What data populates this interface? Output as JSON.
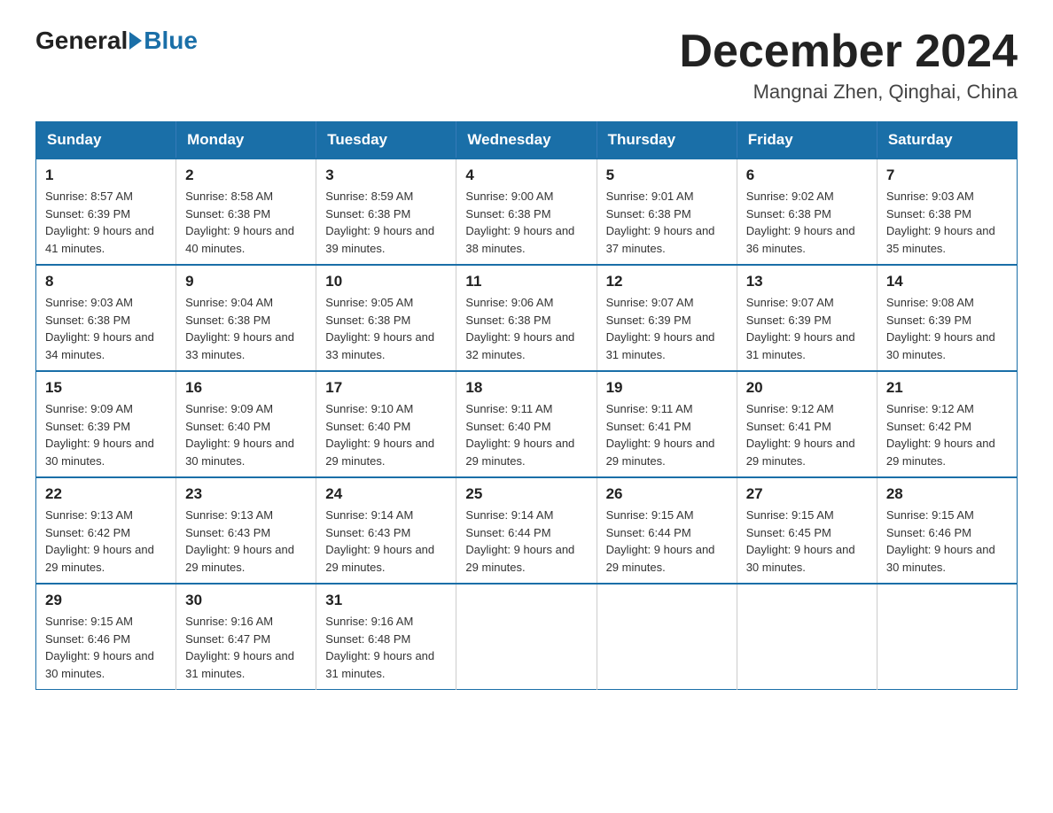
{
  "header": {
    "logo_general": "General",
    "logo_blue": "Blue",
    "month_title": "December 2024",
    "location": "Mangnai Zhen, Qinghai, China"
  },
  "days_of_week": [
    "Sunday",
    "Monday",
    "Tuesday",
    "Wednesday",
    "Thursday",
    "Friday",
    "Saturday"
  ],
  "weeks": [
    [
      {
        "day": "1",
        "sunrise": "8:57 AM",
        "sunset": "6:39 PM",
        "daylight": "9 hours and 41 minutes."
      },
      {
        "day": "2",
        "sunrise": "8:58 AM",
        "sunset": "6:38 PM",
        "daylight": "9 hours and 40 minutes."
      },
      {
        "day": "3",
        "sunrise": "8:59 AM",
        "sunset": "6:38 PM",
        "daylight": "9 hours and 39 minutes."
      },
      {
        "day": "4",
        "sunrise": "9:00 AM",
        "sunset": "6:38 PM",
        "daylight": "9 hours and 38 minutes."
      },
      {
        "day": "5",
        "sunrise": "9:01 AM",
        "sunset": "6:38 PM",
        "daylight": "9 hours and 37 minutes."
      },
      {
        "day": "6",
        "sunrise": "9:02 AM",
        "sunset": "6:38 PM",
        "daylight": "9 hours and 36 minutes."
      },
      {
        "day": "7",
        "sunrise": "9:03 AM",
        "sunset": "6:38 PM",
        "daylight": "9 hours and 35 minutes."
      }
    ],
    [
      {
        "day": "8",
        "sunrise": "9:03 AM",
        "sunset": "6:38 PM",
        "daylight": "9 hours and 34 minutes."
      },
      {
        "day": "9",
        "sunrise": "9:04 AM",
        "sunset": "6:38 PM",
        "daylight": "9 hours and 33 minutes."
      },
      {
        "day": "10",
        "sunrise": "9:05 AM",
        "sunset": "6:38 PM",
        "daylight": "9 hours and 33 minutes."
      },
      {
        "day": "11",
        "sunrise": "9:06 AM",
        "sunset": "6:38 PM",
        "daylight": "9 hours and 32 minutes."
      },
      {
        "day": "12",
        "sunrise": "9:07 AM",
        "sunset": "6:39 PM",
        "daylight": "9 hours and 31 minutes."
      },
      {
        "day": "13",
        "sunrise": "9:07 AM",
        "sunset": "6:39 PM",
        "daylight": "9 hours and 31 minutes."
      },
      {
        "day": "14",
        "sunrise": "9:08 AM",
        "sunset": "6:39 PM",
        "daylight": "9 hours and 30 minutes."
      }
    ],
    [
      {
        "day": "15",
        "sunrise": "9:09 AM",
        "sunset": "6:39 PM",
        "daylight": "9 hours and 30 minutes."
      },
      {
        "day": "16",
        "sunrise": "9:09 AM",
        "sunset": "6:40 PM",
        "daylight": "9 hours and 30 minutes."
      },
      {
        "day": "17",
        "sunrise": "9:10 AM",
        "sunset": "6:40 PM",
        "daylight": "9 hours and 29 minutes."
      },
      {
        "day": "18",
        "sunrise": "9:11 AM",
        "sunset": "6:40 PM",
        "daylight": "9 hours and 29 minutes."
      },
      {
        "day": "19",
        "sunrise": "9:11 AM",
        "sunset": "6:41 PM",
        "daylight": "9 hours and 29 minutes."
      },
      {
        "day": "20",
        "sunrise": "9:12 AM",
        "sunset": "6:41 PM",
        "daylight": "9 hours and 29 minutes."
      },
      {
        "day": "21",
        "sunrise": "9:12 AM",
        "sunset": "6:42 PM",
        "daylight": "9 hours and 29 minutes."
      }
    ],
    [
      {
        "day": "22",
        "sunrise": "9:13 AM",
        "sunset": "6:42 PM",
        "daylight": "9 hours and 29 minutes."
      },
      {
        "day": "23",
        "sunrise": "9:13 AM",
        "sunset": "6:43 PM",
        "daylight": "9 hours and 29 minutes."
      },
      {
        "day": "24",
        "sunrise": "9:14 AM",
        "sunset": "6:43 PM",
        "daylight": "9 hours and 29 minutes."
      },
      {
        "day": "25",
        "sunrise": "9:14 AM",
        "sunset": "6:44 PM",
        "daylight": "9 hours and 29 minutes."
      },
      {
        "day": "26",
        "sunrise": "9:15 AM",
        "sunset": "6:44 PM",
        "daylight": "9 hours and 29 minutes."
      },
      {
        "day": "27",
        "sunrise": "9:15 AM",
        "sunset": "6:45 PM",
        "daylight": "9 hours and 30 minutes."
      },
      {
        "day": "28",
        "sunrise": "9:15 AM",
        "sunset": "6:46 PM",
        "daylight": "9 hours and 30 minutes."
      }
    ],
    [
      {
        "day": "29",
        "sunrise": "9:15 AM",
        "sunset": "6:46 PM",
        "daylight": "9 hours and 30 minutes."
      },
      {
        "day": "30",
        "sunrise": "9:16 AM",
        "sunset": "6:47 PM",
        "daylight": "9 hours and 31 minutes."
      },
      {
        "day": "31",
        "sunrise": "9:16 AM",
        "sunset": "6:48 PM",
        "daylight": "9 hours and 31 minutes."
      },
      null,
      null,
      null,
      null
    ]
  ]
}
